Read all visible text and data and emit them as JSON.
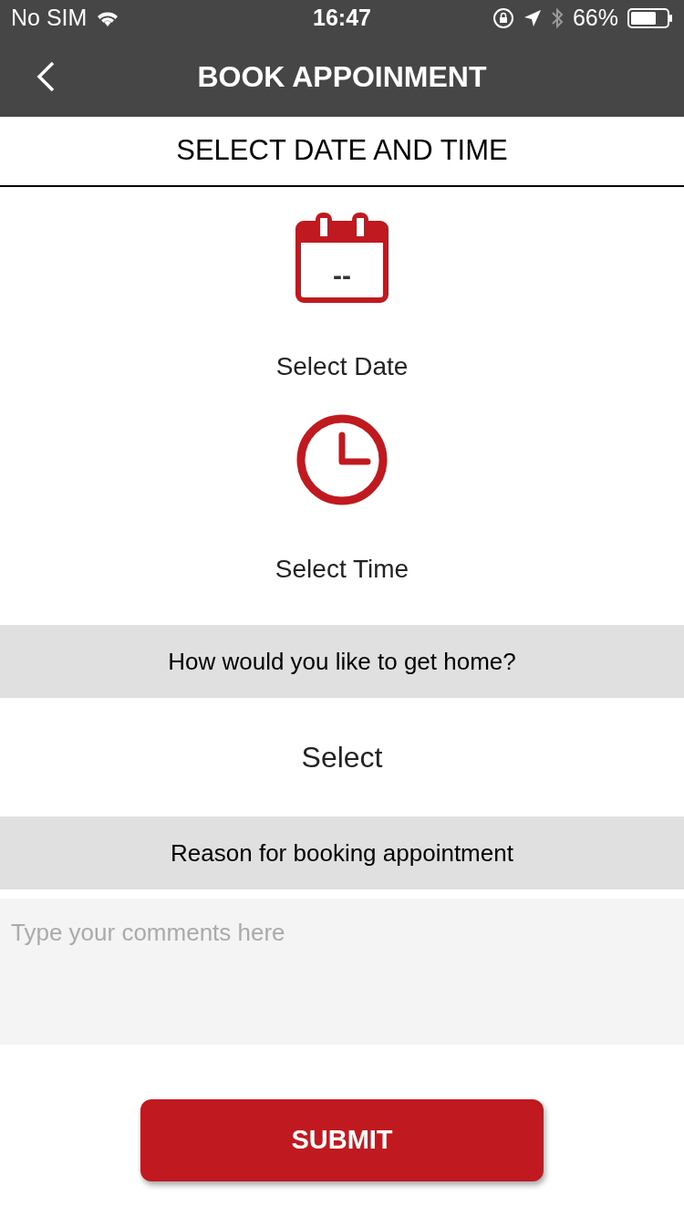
{
  "status_bar": {
    "carrier": "No SIM",
    "time": "16:47",
    "battery": "66%"
  },
  "nav": {
    "title": "BOOK APPOINMENT"
  },
  "section_title": "SELECT DATE AND TIME",
  "date": {
    "icon_text": "--",
    "label": "Select Date"
  },
  "time": {
    "label": "Select Time"
  },
  "transport": {
    "question": "How would you like to get home?",
    "value": "Select"
  },
  "reason": {
    "heading": "Reason for booking appointment",
    "placeholder": "Type your comments here"
  },
  "submit": "SUBMIT"
}
